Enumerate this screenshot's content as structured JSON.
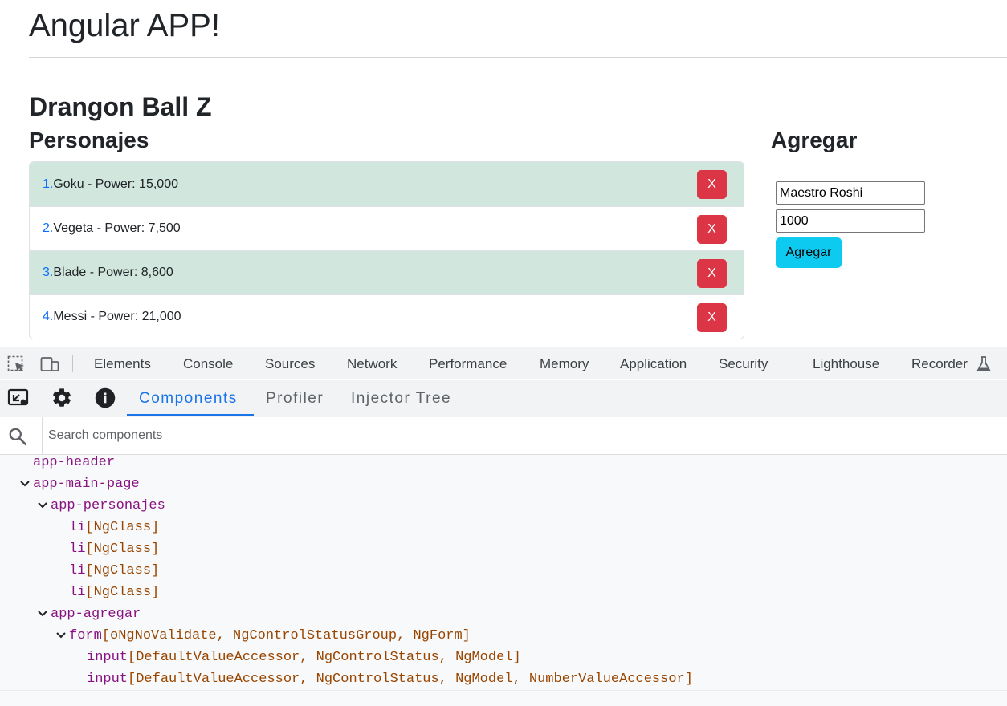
{
  "app": {
    "title": "Angular APP!",
    "section_title": "Drangon Ball Z",
    "list_title": "Personajes",
    "add_title": "Agregar",
    "characters": [
      {
        "num": "1.",
        "text": "Goku - Power: 15,000",
        "highlight": true,
        "remove_label": "X"
      },
      {
        "num": "2.",
        "text": "Vegeta - Power: 7,500",
        "highlight": false,
        "remove_label": "X"
      },
      {
        "num": "3.",
        "text": "Blade - Power: 8,600",
        "highlight": true,
        "remove_label": "X"
      },
      {
        "num": "4.",
        "text": "Messi - Power: 21,000",
        "highlight": false,
        "remove_label": "X"
      }
    ],
    "form": {
      "name_value": "Maestro Roshi",
      "power_value": "1000",
      "submit_label": "Agregar"
    }
  },
  "devtools": {
    "tabs": [
      "Elements",
      "Console",
      "Sources",
      "Network",
      "Performance",
      "Memory",
      "Application",
      "Security",
      "Lighthouse",
      "Recorder"
    ],
    "angular_tabs": [
      "Components",
      "Profiler",
      "Injector Tree"
    ],
    "active_angular_tab": "Components",
    "search_placeholder": "Search components",
    "tree": [
      {
        "tag": "app-header",
        "directives": ""
      },
      {
        "tag": "app-main-page",
        "directives": ""
      },
      {
        "tag": "app-personajes",
        "directives": ""
      },
      {
        "tag": "li",
        "directives": "[NgClass]"
      },
      {
        "tag": "li",
        "directives": "[NgClass]"
      },
      {
        "tag": "li",
        "directives": "[NgClass]"
      },
      {
        "tag": "li",
        "directives": "[NgClass]"
      },
      {
        "tag": "app-agregar",
        "directives": ""
      },
      {
        "tag": "form",
        "directives": "[ɵNgNoValidate, NgControlStatusGroup, NgForm]"
      },
      {
        "tag": "input",
        "directives": "[DefaultValueAccessor, NgControlStatus, NgModel]"
      },
      {
        "tag": "input",
        "directives": "[DefaultValueAccessor, NgControlStatus, NgModel, NumberValueAccessor]"
      }
    ]
  },
  "colors": {
    "highlight_row": "#d1e7dd",
    "danger": "#dc3545",
    "info": "#0dcaf0",
    "angular_active": "#1a73e8",
    "tag": "#881280",
    "directive": "#994500"
  }
}
